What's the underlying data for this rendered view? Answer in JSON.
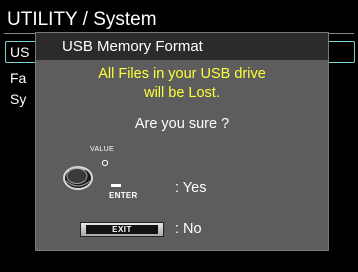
{
  "header": {
    "title": "UTILITY / System"
  },
  "menu": {
    "items": [
      {
        "label": "US"
      },
      {
        "label": "Fa"
      },
      {
        "label": "Sy"
      }
    ]
  },
  "dialog": {
    "title": "USB Memory Format",
    "warning_line1": "All Files in your USB drive",
    "warning_line2": "will be Lost.",
    "confirm": "Are you sure ?",
    "value_label": "VALUE",
    "enter_label": "ENTER",
    "yes_text": ": Yes",
    "exit_label": "EXIT",
    "no_text": ": No"
  },
  "colors": {
    "warning": "#ffff3a",
    "selection_outline": "#7fd6cc",
    "dialog_bg": "#5d5d5d",
    "dialog_header_bg": "#2b2b2b"
  },
  "icons": {
    "knob": "value-knob-icon"
  }
}
